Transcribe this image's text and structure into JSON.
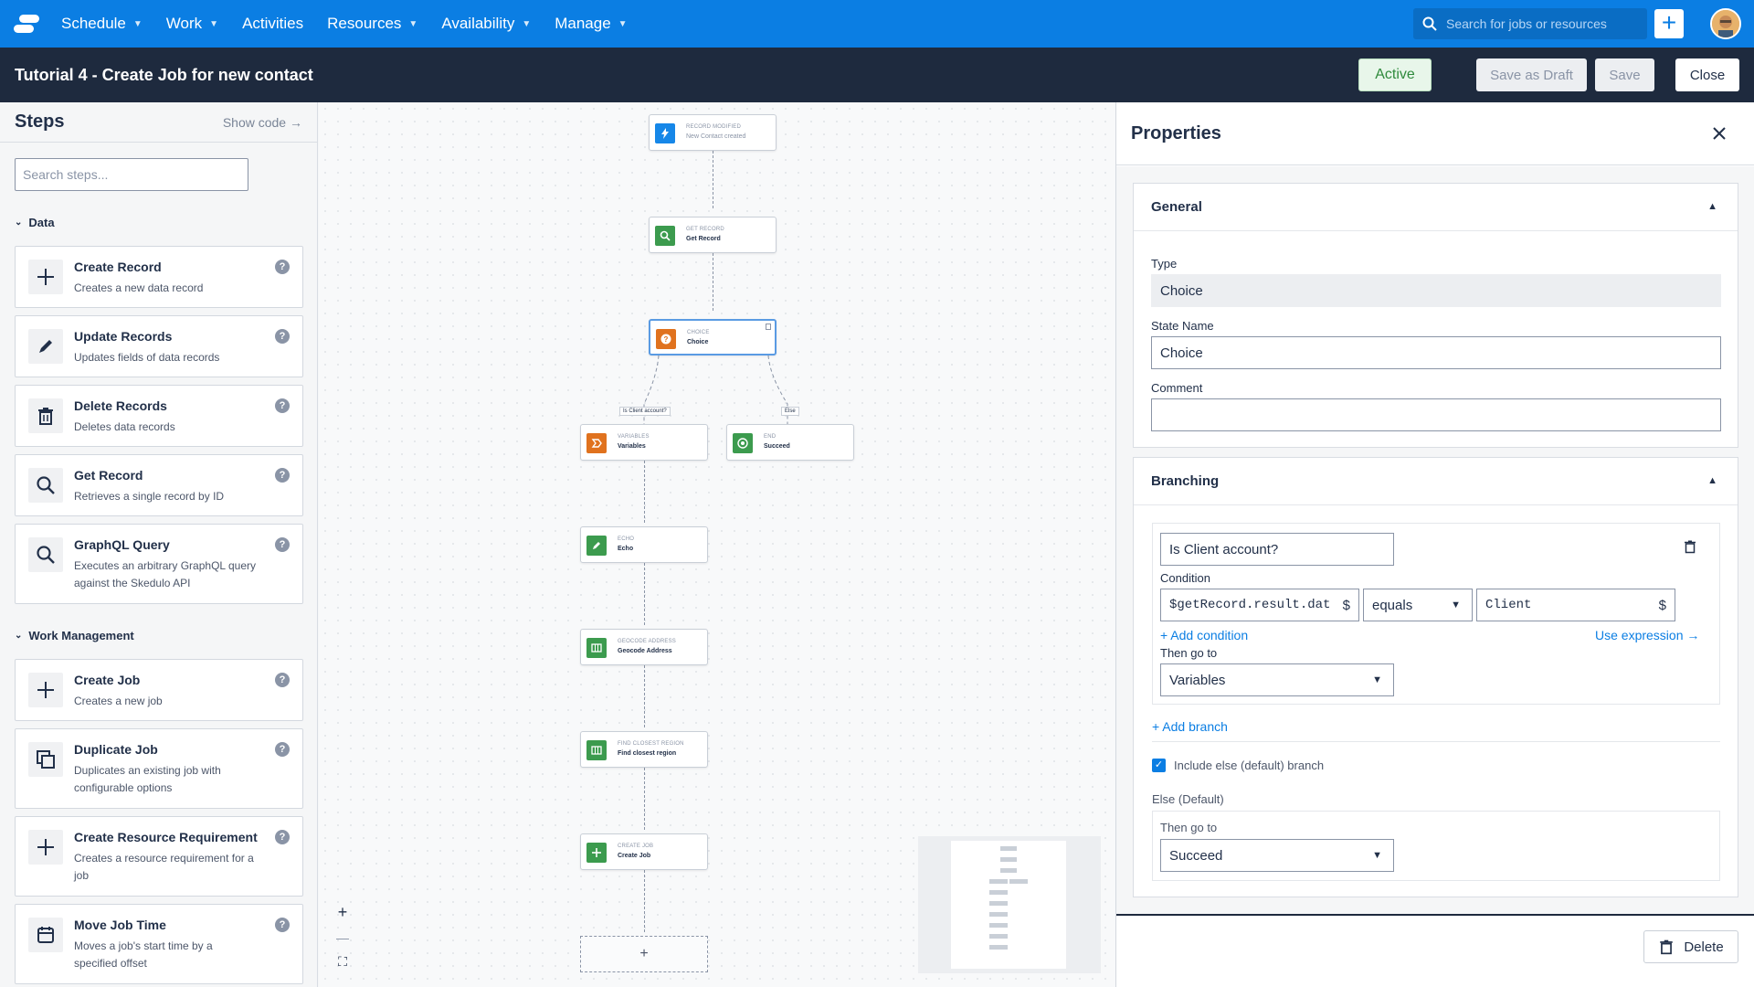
{
  "nav": {
    "items": [
      {
        "label": "Schedule",
        "caret": true
      },
      {
        "label": "Work",
        "caret": true
      },
      {
        "label": "Activities",
        "caret": false
      },
      {
        "label": "Resources",
        "caret": true
      },
      {
        "label": "Availability",
        "caret": true
      },
      {
        "label": "Manage",
        "caret": true
      }
    ],
    "search_placeholder": "Search for jobs or resources",
    "plus": "+"
  },
  "titlebar": {
    "title": "Tutorial 4 - Create Job for new contact",
    "active": "Active",
    "save_draft": "Save as Draft",
    "save": "Save",
    "close": "Close"
  },
  "steps": {
    "title": "Steps",
    "show_code": "Show code →",
    "search_placeholder": "Search steps...",
    "sections": [
      {
        "label": "Data"
      },
      {
        "label": "Work Management"
      }
    ],
    "cards": [
      {
        "name": "Create Record",
        "desc": "Creates a new data record",
        "icon": "plus-icon"
      },
      {
        "name": "Update Records",
        "desc": "Updates fields of data records",
        "icon": "pencil-icon"
      },
      {
        "name": "Delete Records",
        "desc": "Deletes data records",
        "icon": "trash-icon"
      },
      {
        "name": "Get Record",
        "desc": "Retrieves a single record by ID",
        "icon": "search-icon"
      },
      {
        "name": "GraphQL Query",
        "desc": "Executes an arbitrary GraphQL query against the Skedulo API",
        "icon": "search-icon"
      },
      {
        "name": "Create Job",
        "desc": "Creates a new job",
        "icon": "plus-icon"
      },
      {
        "name": "Duplicate Job",
        "desc": "Duplicates an existing job with configurable options",
        "icon": "duplicate-icon"
      },
      {
        "name": "Create Resource Requirement",
        "desc": "Creates a resource requirement for a job",
        "icon": "plus-icon"
      },
      {
        "name": "Move Job Time",
        "desc": "Moves a job's start time by a specified offset",
        "icon": "calendar-icon"
      }
    ],
    "help": "?"
  },
  "canvas": {
    "nodes": [
      {
        "type": "Record modified",
        "name": "New Contact created",
        "color": "#1687e8",
        "icon": "lightning-icon"
      },
      {
        "type": "Get record",
        "name": "Get Record",
        "color": "#3c9b4e",
        "icon": "search-icon"
      },
      {
        "type": "Choice",
        "name": "Choice",
        "color": "#e0721e",
        "icon": "question-icon"
      },
      {
        "type": "Variables",
        "name": "Variables",
        "color": "#e0721e",
        "icon": "variables-icon"
      },
      {
        "type": "End",
        "name": "Succeed",
        "color": "#3c9b4e",
        "icon": "target-icon"
      },
      {
        "type": "Echo",
        "name": "Echo",
        "color": "#3c9b4e",
        "icon": "pencil-icon"
      },
      {
        "type": "Geocode address",
        "name": "Geocode Address",
        "color": "#3c9b4e",
        "icon": "map-icon"
      },
      {
        "type": "Find closest region",
        "name": "Find closest region",
        "color": "#3c9b4e",
        "icon": "map-icon"
      },
      {
        "type": "Create job",
        "name": "Create Job",
        "color": "#3c9b4e",
        "icon": "plus-icon"
      }
    ],
    "branch_labels": [
      "Is Client account?",
      "Else"
    ],
    "add_step": "+",
    "zoom": [
      "+",
      "—",
      "⛶"
    ]
  },
  "properties": {
    "title": "Properties",
    "general": {
      "header": "General",
      "type_label": "Type",
      "type_value": "Choice",
      "state_name_label": "State Name",
      "state_name_value": "Choice",
      "comment_label": "Comment",
      "comment_value": ""
    },
    "branching": {
      "header": "Branching",
      "branch_name": "Is Client account?",
      "condition_label": "Condition",
      "condition_left": "$getRecord.result.dat",
      "operator": "equals",
      "condition_right": "Client",
      "dollar": "$",
      "add_condition": "+ Add condition",
      "use_expression": "Use expression →",
      "then_go_to_label": "Then go to",
      "then_go_to_value": "Variables",
      "add_branch": "+ Add branch",
      "include_else": "Include else (default) branch",
      "else_label": "Else (Default)",
      "else_then_label": "Then go to",
      "else_then_value": "Succeed"
    },
    "delete": "Delete"
  },
  "colors": {
    "nav_blue": "#0b7ee3",
    "titlebar_dark": "#1e2a3e",
    "active_green": "#2f8a3c"
  }
}
